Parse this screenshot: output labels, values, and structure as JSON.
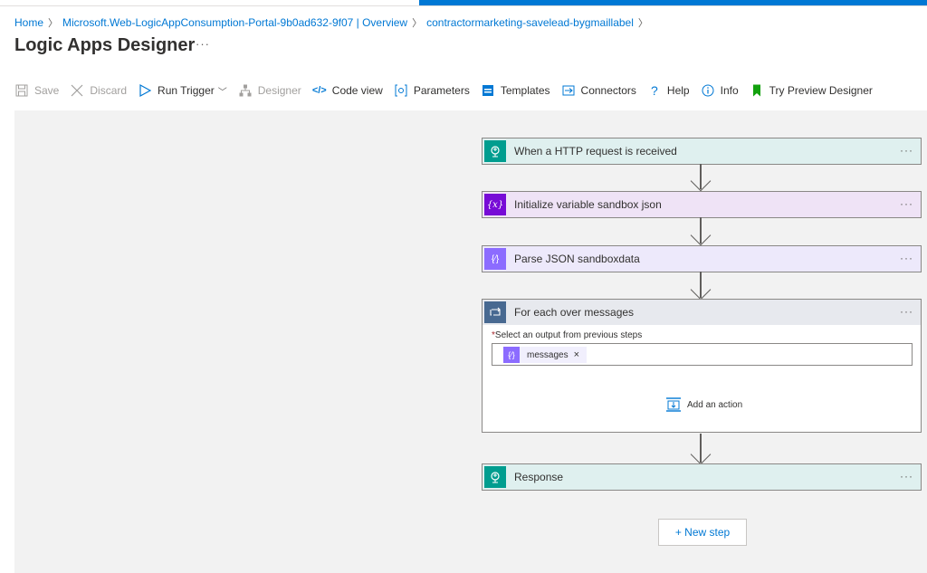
{
  "breadcrumb": {
    "home": "Home",
    "resource": "Microsoft.Web-LogicAppConsumption-Portal-9b0ad632-9f07 | Overview",
    "app": "contractormarketing-savelead-bygmaillabel"
  },
  "page": {
    "title": "Logic Apps Designer",
    "more": "···"
  },
  "toolbar": {
    "save": "Save",
    "discard": "Discard",
    "run_trigger": "Run Trigger",
    "designer": "Designer",
    "code_view": "Code view",
    "parameters": "Parameters",
    "templates": "Templates",
    "connectors": "Connectors",
    "help": "Help",
    "info": "Info",
    "try_preview": "Try Preview Designer"
  },
  "steps": {
    "trigger": {
      "label": "When a HTTP request is received",
      "icon": "http-request-icon"
    },
    "init_var": {
      "label": "Initialize variable sandbox json",
      "icon": "variable-icon",
      "badge": "{x}"
    },
    "parse_json": {
      "label": "Parse JSON sandboxdata",
      "icon": "parse-json-icon",
      "badge": "{⁄}"
    },
    "foreach": {
      "label": "For each over messages",
      "icon": "loop-icon",
      "field_label": "Select an output from previous steps",
      "required_mark": "*",
      "token": "messages",
      "token_badge": "{⁄}",
      "token_remove": "×",
      "add_action": "Add an action"
    },
    "response": {
      "label": "Response",
      "icon": "http-response-icon"
    },
    "more": "···"
  },
  "new_step": "+ New step",
  "colors": {
    "accent": "#0078d4",
    "http": "#009d8f",
    "variable": "#770bd6",
    "parse": "#8c6cff",
    "loop": "#486991",
    "canvas": "#f2f2f2"
  }
}
